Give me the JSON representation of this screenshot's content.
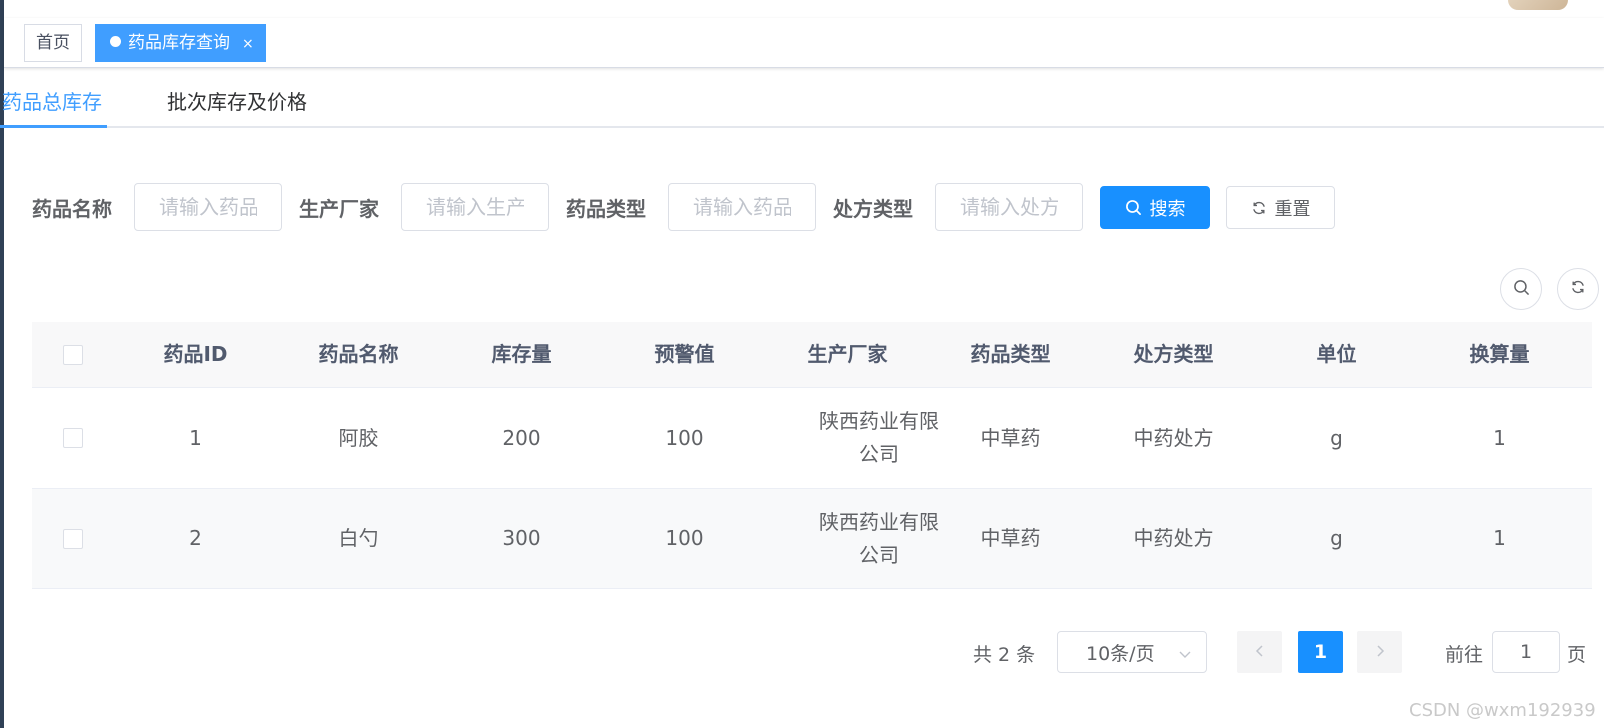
{
  "tags": [
    {
      "label": "首页",
      "active": false
    },
    {
      "label": "药品库存查询",
      "active": true,
      "close": "×"
    }
  ],
  "tabs": [
    {
      "label": "药品总库存",
      "active": true
    },
    {
      "label": "批次库存及价格",
      "active": false
    }
  ],
  "search_form": {
    "drug_name": {
      "label": "药品名称",
      "placeholder": "请输入药品名称",
      "value": ""
    },
    "manufacturer": {
      "label": "生产厂家",
      "placeholder": "请输入生产厂家",
      "value": ""
    },
    "drug_type": {
      "label": "药品类型",
      "placeholder": "请输入药品类型",
      "value": ""
    },
    "prescription_type": {
      "label": "处方类型",
      "placeholder": "请输入处方类型",
      "value": ""
    },
    "search_button": "搜索",
    "reset_button": "重置"
  },
  "toolbar": {
    "search_icon": "search-icon",
    "refresh_icon": "refresh-icon"
  },
  "table": {
    "headers": [
      "药品ID",
      "药品名称",
      "库存量",
      "预警值",
      "生产厂家",
      "药品类型",
      "处方类型",
      "单位",
      "换算量"
    ],
    "rows": [
      [
        "1",
        "阿胶",
        "200",
        "100",
        "陕西药业有限公司",
        "中草药",
        "中药处方",
        "g",
        "1"
      ],
      [
        "2",
        "白勺",
        "300",
        "100",
        "陕西药业有限公司",
        "中草药",
        "中药处方",
        "g",
        "1"
      ]
    ]
  },
  "pagination": {
    "total_text": "共 2 条",
    "page_size": "10条/页",
    "current_page": "1",
    "goto_prefix": "前往",
    "goto_value": "1",
    "goto_suffix": "页"
  },
  "watermark": "CSDN @wxm192939",
  "colors": {
    "primary": "#1890ff",
    "tag_active": "#409eff"
  }
}
